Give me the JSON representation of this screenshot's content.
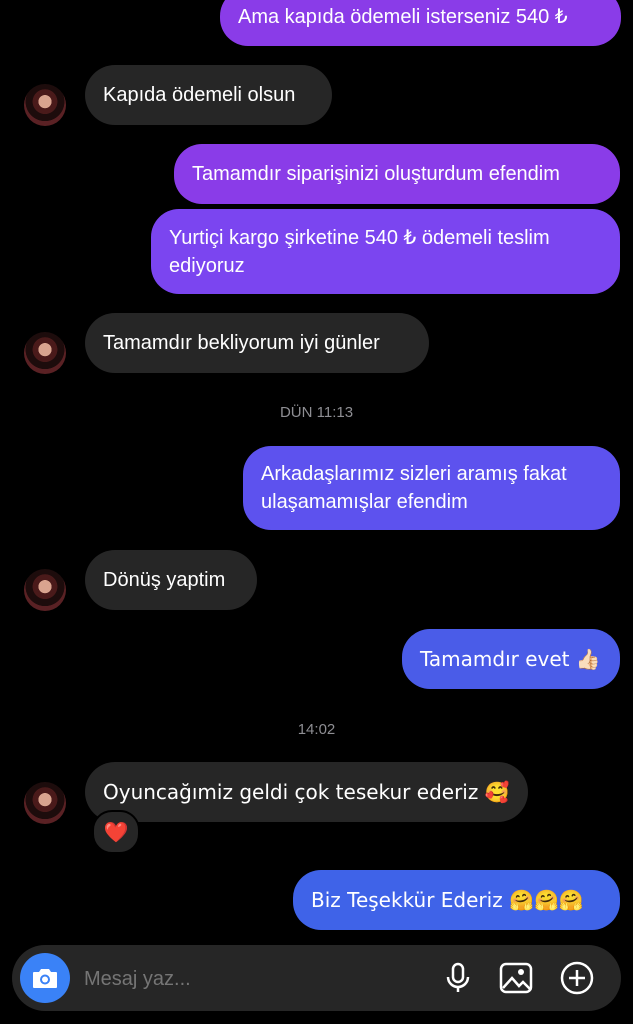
{
  "messages": [
    {
      "text": "Ama kapıda ödemeli isterseniz 540 ₺"
    },
    {
      "text": "Kapıda ödemeli olsun"
    },
    {
      "text": "Tamamdır siparişinizi oluşturdum efendim"
    },
    {
      "text": "Yurtiçi kargo şirketine 540 ₺ ödemeli teslim ediyoruz"
    },
    {
      "text": "Tamamdır bekliyorum iyi günler"
    },
    {
      "text": "Arkadaşlarımız sizleri aramış fakat ulaşamamışlar efendim"
    },
    {
      "text": "Dönüş yaptim"
    },
    {
      "text": "Tamamdır evet 👍🏻"
    },
    {
      "text": "Oyuncağımiz geldi çok tesekur ederiz 🥰"
    },
    {
      "text": "Biz Teşekkür Ederiz 🤗🤗🤗"
    }
  ],
  "timestamps": [
    "DÜN 11:13",
    "14:02"
  ],
  "reaction": "❤️",
  "composer": {
    "placeholder": "Mesaj yaz..."
  },
  "icons": {
    "camera": "camera-icon",
    "mic": "microphone-icon",
    "gallery": "gallery-icon",
    "plus": "plus-circle-icon"
  },
  "colors": {
    "background": "#000000",
    "incoming_bubble": "#262626",
    "outgoing_gradient": [
      "#8a3ce8",
      "#3f63e8"
    ],
    "camera_button": "#3a82f7"
  }
}
